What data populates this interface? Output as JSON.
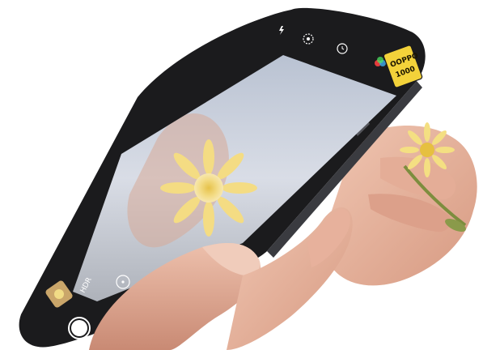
{
  "scene": {
    "accent_sticker_color": "#f3d23a",
    "flower_color": "#f2da7a",
    "phone_body_color": "#1b1b1d",
    "screen_sky_color": "#cfd6e2"
  },
  "sticker": {
    "line1": "OOPPO",
    "line2": "1000"
  },
  "camera_ui": {
    "icons": [
      "flash-icon",
      "live-photo-icon",
      "timer-icon",
      "filter-icon",
      "shutter-button",
      "thumbnail-icon"
    ],
    "mode_label": "HDR"
  }
}
